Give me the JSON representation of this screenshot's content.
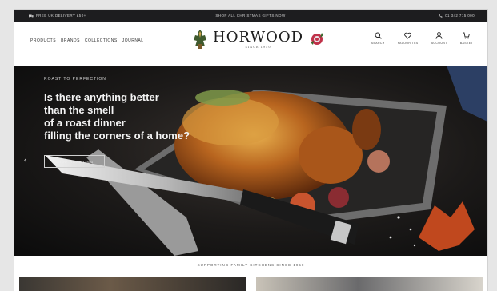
{
  "topbar": {
    "left": "Free UK Delivery £50+",
    "middle": "Shop all Christmas gifts now",
    "right": "01 342 715 000",
    "left_icon": "truck-icon",
    "right_icon": "phone-icon"
  },
  "nav": {
    "items": [
      {
        "label": "Products"
      },
      {
        "label": "Brands"
      },
      {
        "label": "Collections"
      },
      {
        "label": "Journal"
      }
    ]
  },
  "logo": {
    "brand": "HORWOOD",
    "subtitle": "SINCE 1950"
  },
  "actions": [
    {
      "label": "Search",
      "icon": "search-icon"
    },
    {
      "label": "Favourites",
      "icon": "heart-icon"
    },
    {
      "label": "Account",
      "icon": "user-icon"
    },
    {
      "label": "Basket",
      "icon": "basket-icon"
    }
  ],
  "hero": {
    "eyebrow": "Roast to perfection",
    "headline": [
      "Is there anything better",
      "than the smell",
      "of a roast dinner",
      "filling the corners of a home?"
    ],
    "cta": "Shop roasting",
    "prev_arrow": "‹"
  },
  "strap": "Supporting family kitchens since 1950",
  "colors": {
    "topbar_bg": "#1d1d1f",
    "hero_bg": "#111111",
    "text_dark": "#1e1e1e"
  }
}
